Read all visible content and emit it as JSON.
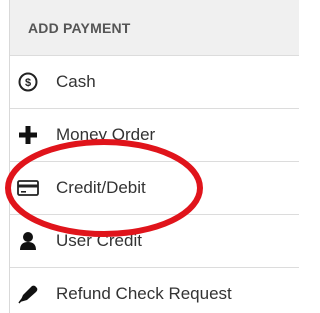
{
  "header": {
    "title": "ADD PAYMENT"
  },
  "menu": {
    "items": [
      {
        "id": "cash",
        "icon": "dollar-coin-icon",
        "label": "Cash"
      },
      {
        "id": "money-order",
        "icon": "plus-icon",
        "label": "Money Order"
      },
      {
        "id": "credit-debit",
        "icon": "credit-card-icon",
        "label": "Credit/Debit"
      },
      {
        "id": "user-credit",
        "icon": "user-icon",
        "label": "User Credit"
      },
      {
        "id": "refund-check",
        "icon": "pen-icon",
        "label": "Refund Check Request"
      }
    ]
  },
  "colors": {
    "annotation": "#e0141b",
    "header_bg": "#f0f0f0",
    "border": "#dcdcdc"
  }
}
